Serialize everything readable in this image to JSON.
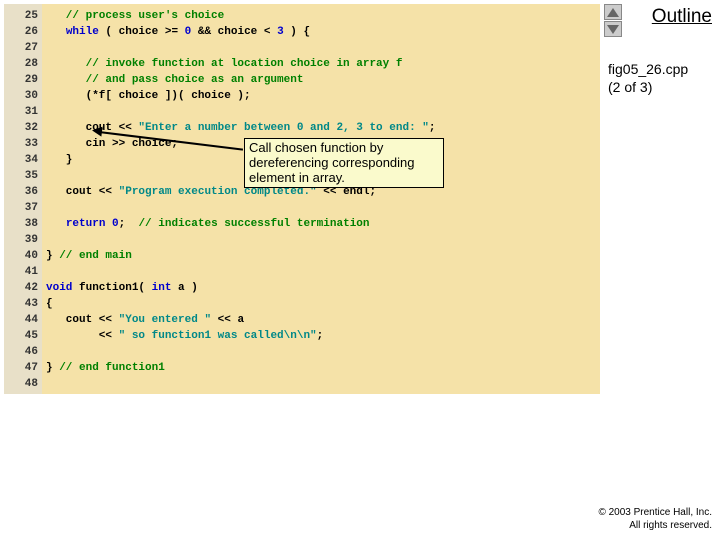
{
  "sidebar": {
    "outline": "Outline",
    "fig_line1": "fig05_26.cpp",
    "fig_line2": "(2 of 3)"
  },
  "copyright": {
    "line1": "© 2003 Prentice Hall, Inc.",
    "line2": "All rights reserved."
  },
  "callout": {
    "line1": "Call chosen function by",
    "line2": "dereferencing corresponding",
    "line3": "element in array."
  },
  "lines": {
    "25": "25",
    "26": "26",
    "27": "27",
    "28": "28",
    "29": "29",
    "30": "30",
    "31": "31",
    "32": "32",
    "33": "33",
    "34": "34",
    "35": "35",
    "36": "36",
    "37": "37",
    "38": "38",
    "39": "39",
    "40": "40",
    "41": "41",
    "42": "42",
    "43": "43",
    "44": "44",
    "45": "45",
    "46": "46",
    "47": "47",
    "48": "48"
  },
  "c": {
    "l25": "   // process user's choice",
    "l26a": "   ",
    "l26_while": "while",
    "l26b": " ( choice >= ",
    "l26_zero": "0",
    "l26c": " && choice < ",
    "l26_three": "3",
    "l26d": " ) {",
    "l28": "      // invoke function at location choice in array f",
    "l29": "      // and pass choice as an argument",
    "l30": "      (*f[ choice ])( choice );",
    "l32a": "      cout << ",
    "l32_str": "\"Enter a number between 0 and 2, 3 to end: \"",
    "l32b": ";",
    "l33": "      cin >> choice;",
    "l34": "   }",
    "l36a": "   cout << ",
    "l36_str": "\"Program execution completed.\"",
    "l36b": " << endl;",
    "l38a": "   ",
    "l38_return": "return",
    "l38b": " ",
    "l38_zero": "0",
    "l38c": ";  ",
    "l38_comment": "// indicates successful termination",
    "l40a": "} ",
    "l40_comment": "// end main",
    "l42a": "void",
    "l42b": " function1( ",
    "l42c": "int",
    "l42d": " a )",
    "l43": "{",
    "l44a": "   cout << ",
    "l44_str": "\"You entered \"",
    "l44b": " << a",
    "l45a": "        << ",
    "l45_str": "\" so function1 was called\\n\\n\"",
    "l45b": ";",
    "l47a": "} ",
    "l47_comment": "// end function1"
  }
}
